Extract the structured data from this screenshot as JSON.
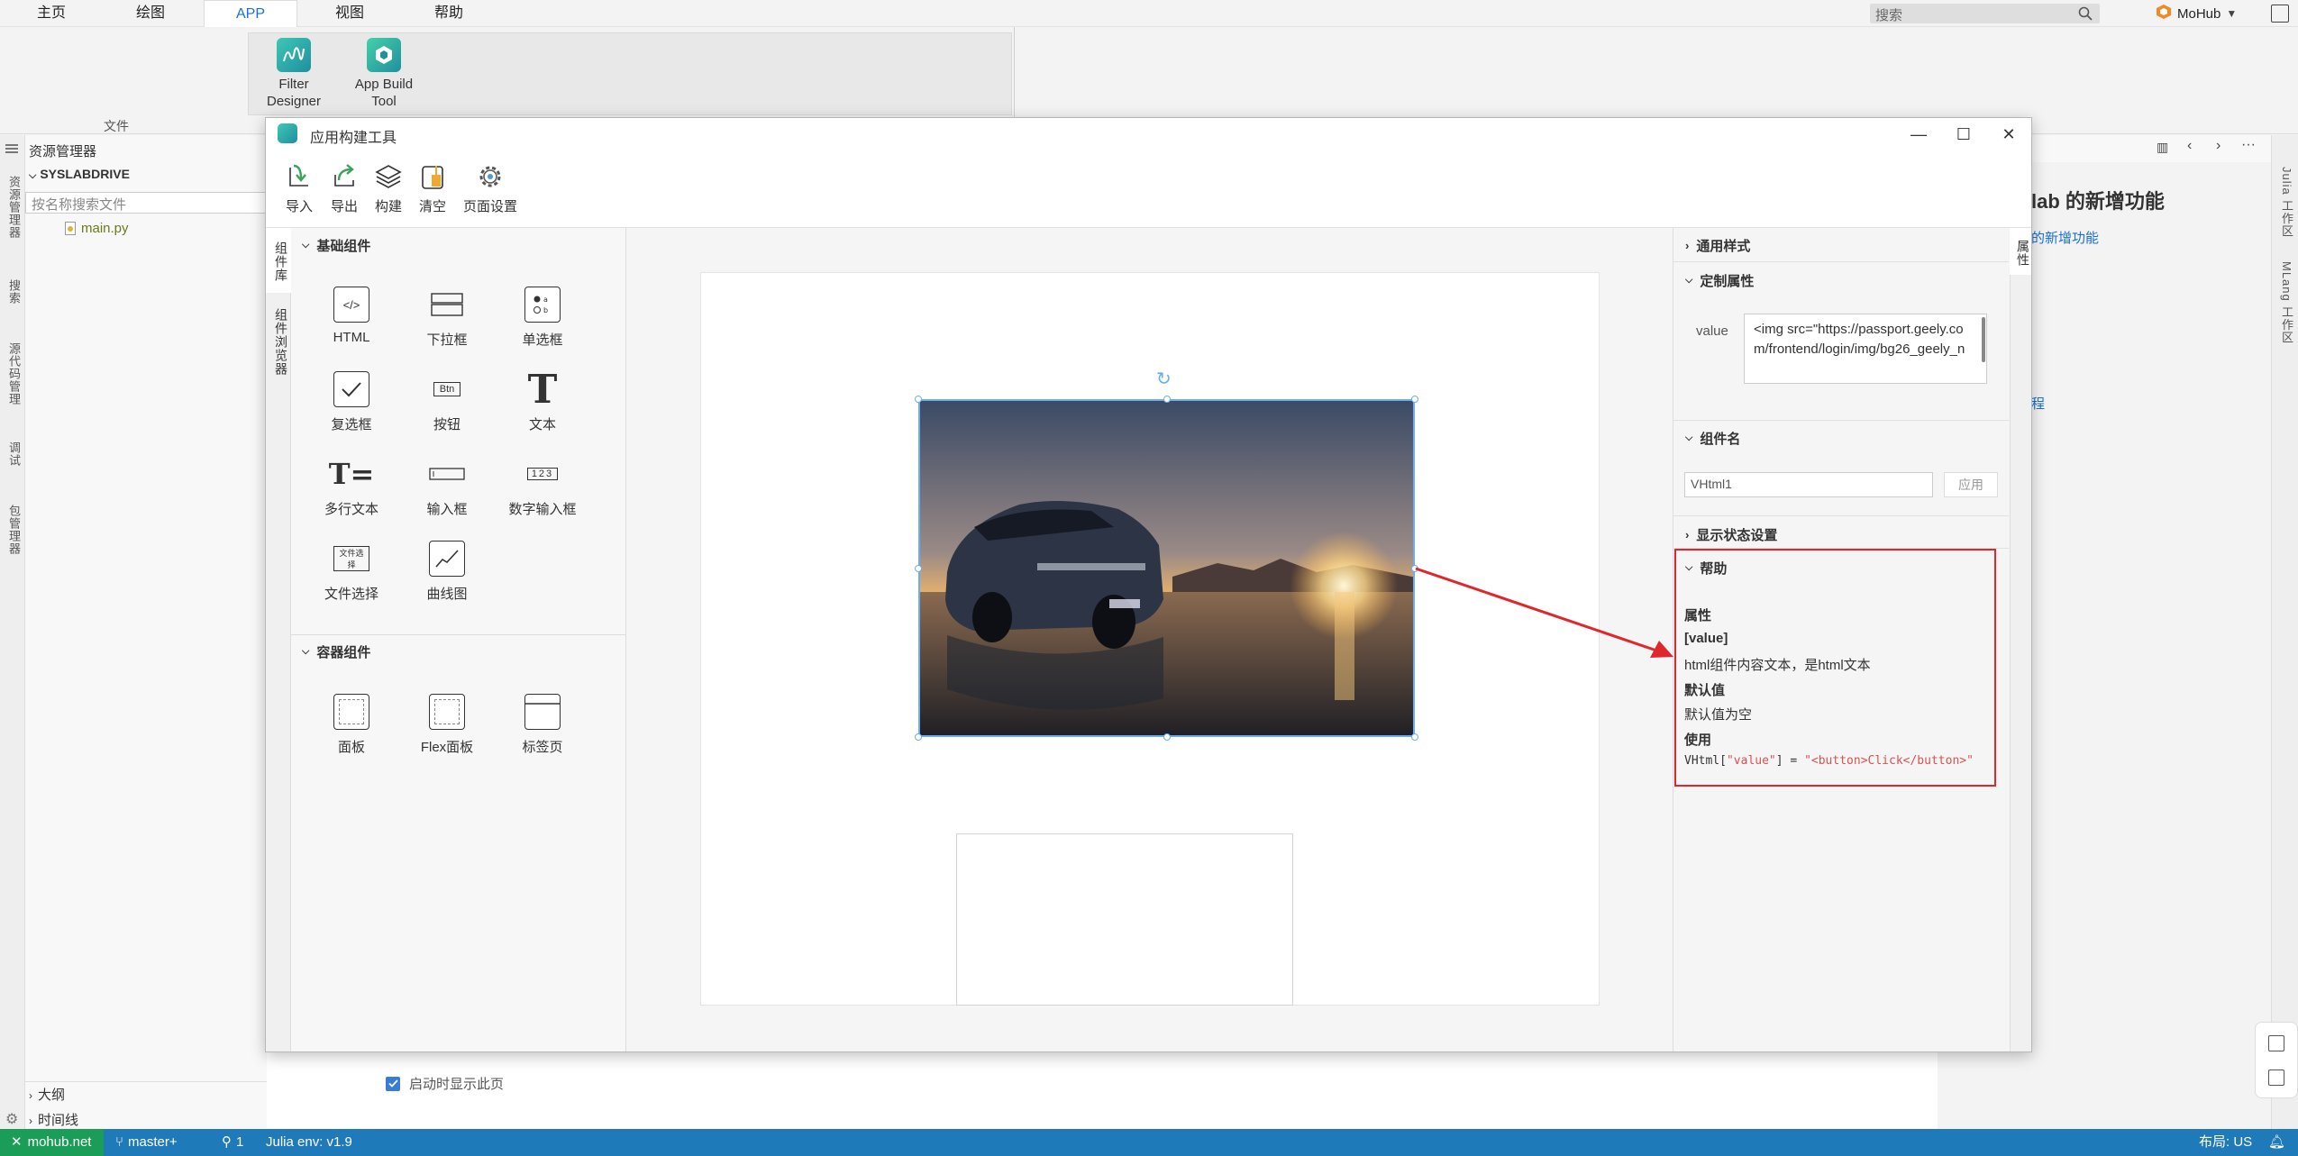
{
  "menubar": {
    "tabs": [
      "主页",
      "绘图",
      "APP",
      "视图",
      "帮助"
    ],
    "active_tab": "APP",
    "search_placeholder": "搜索",
    "user": "MoHub"
  },
  "ribbon": {
    "file_label": "文件",
    "buttons": [
      {
        "label_line1": "Filter",
        "label_line2": "Designer"
      },
      {
        "label_line1": "App Build",
        "label_line2": "Tool"
      }
    ]
  },
  "activity_bar": {
    "items": [
      "资源管理器",
      "搜索",
      "源代码管理",
      "调试",
      "包管理器"
    ]
  },
  "explorer": {
    "title": "资源管理器",
    "root": "SYSLABDRIVE",
    "search_placeholder": "按名称搜索文件",
    "files": [
      "main.py"
    ],
    "outline": "大纲",
    "timeline": "时间线"
  },
  "background": {
    "title": "lab 的新增功能",
    "link1": "的新增功能",
    "link2": "程",
    "startup_checkbox": "启动时显示此页"
  },
  "right_bar": {
    "items": [
      "Julia 工作区",
      "MLang 工作区"
    ]
  },
  "statusbar": {
    "home": "mohub.net",
    "branch": "master+",
    "ports": "1",
    "env": "Julia env: v1.9",
    "layout": "布局: US"
  },
  "dialog": {
    "title": "应用构建工具",
    "toolbar": [
      "导入",
      "导出",
      "构建",
      "清空",
      "页面设置"
    ],
    "vtabs": [
      "组件库",
      "组件浏览器"
    ],
    "basic_section": "基础组件",
    "basic_components": [
      "HTML",
      "下拉框",
      "单选框",
      "复选框",
      "按钮",
      "文本",
      "多行文本",
      "输入框",
      "数字输入框",
      "文件选择",
      "曲线图"
    ],
    "container_section": "容器组件",
    "container_components": [
      "面板",
      "Flex面板",
      "标签页"
    ],
    "icon_glyphs": {
      "html": "</>",
      "button": "Btn",
      "number_input": "123",
      "text": "T",
      "multiline": "T="
    },
    "props_vtab": "属性",
    "props": {
      "common_style": "通用样式",
      "custom_props": "定制属性",
      "value_label": "value",
      "value_text": "<img src=\"https://passport.geely.com/frontend/login/img/bg26_geely_n",
      "component_name_section": "组件名",
      "component_name": "VHtml1",
      "apply": "应用",
      "display_state": "显示状态设置",
      "help": "帮助",
      "help_lines": {
        "attr": "属性",
        "value_key": "[value]",
        "value_desc": "html组件内容文本，是html文本",
        "default": "默认值",
        "default_desc": "默认值为空",
        "usage": "使用"
      },
      "code": {
        "prefix": "VHtml[",
        "key": "\"value\"",
        "mid": "] = ",
        "val": "\"<button>Click</button>\""
      }
    }
  },
  "colors": {
    "accent": "#1a6fd8",
    "status_bar": "#1e7ab8",
    "status_home": "#1a9e57",
    "highlight_red": "#e0262d",
    "selection_blue": "#6aaef0"
  }
}
